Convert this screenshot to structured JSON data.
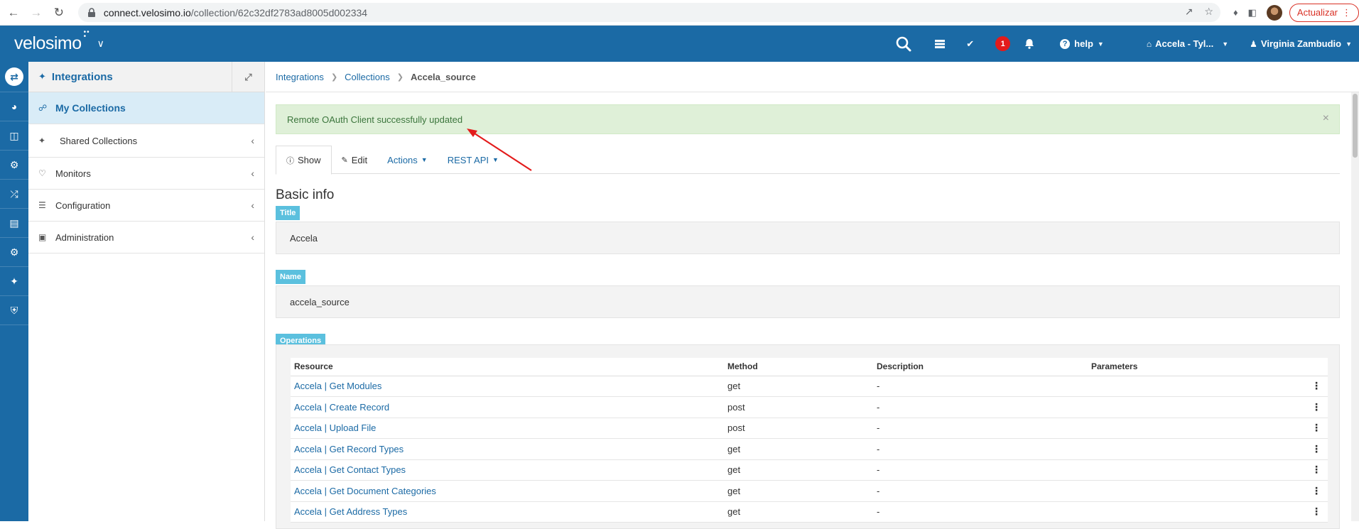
{
  "browser": {
    "url_host": "connect.velosimo.io",
    "url_path": "/collection/62c32df2783ad8005d002334",
    "update_label": "Actualizar"
  },
  "topbar": {
    "logo": "velosimo",
    "notification_count": "1",
    "help_label": "help",
    "tenant_label": "Accela - Tyl...",
    "user_label": "Virginia Zambudio"
  },
  "sidebar": {
    "header": "Integrations",
    "items": [
      {
        "label": "My Collections",
        "icon": "cubes-icon"
      },
      {
        "label": "Shared Collections",
        "icon": "puzzle-icon"
      },
      {
        "label": "Monitors",
        "icon": "heartbeat-icon"
      },
      {
        "label": "Configuration",
        "icon": "sliders-icon"
      },
      {
        "label": "Administration",
        "icon": "lock-icon"
      }
    ]
  },
  "breadcrumb": [
    "Integrations",
    "Collections",
    "Accela_source"
  ],
  "alert": {
    "message": "Remote OAuth Client successfully updated"
  },
  "tabs": {
    "show": "Show",
    "edit": "Edit",
    "actions": "Actions",
    "rest_api": "REST API"
  },
  "basic_info": {
    "heading": "Basic info",
    "title_label": "Title",
    "title_value": "Accela",
    "name_label": "Name",
    "name_value": "accela_source",
    "operations_label": "Operations"
  },
  "operations": {
    "headers": [
      "Resource",
      "Method",
      "Description",
      "Parameters"
    ],
    "rows": [
      {
        "resource": "Accela | Get Modules",
        "method": "get",
        "description": "-"
      },
      {
        "resource": "Accela | Create Record",
        "method": "post",
        "description": "-"
      },
      {
        "resource": "Accela | Upload File",
        "method": "post",
        "description": "-"
      },
      {
        "resource": "Accela | Get Record Types",
        "method": "get",
        "description": "-"
      },
      {
        "resource": "Accela | Get Contact Types",
        "method": "get",
        "description": "-"
      },
      {
        "resource": "Accela | Get Document Categories",
        "method": "get",
        "description": "-"
      },
      {
        "resource": "Accela | Get Address Types",
        "method": "get",
        "description": "-"
      }
    ]
  },
  "colors": {
    "brand": "#1b6aa5",
    "success_bg": "#dff0d8",
    "label_bg": "#5bc0de",
    "annotation_arrow": "#e31b1b"
  }
}
